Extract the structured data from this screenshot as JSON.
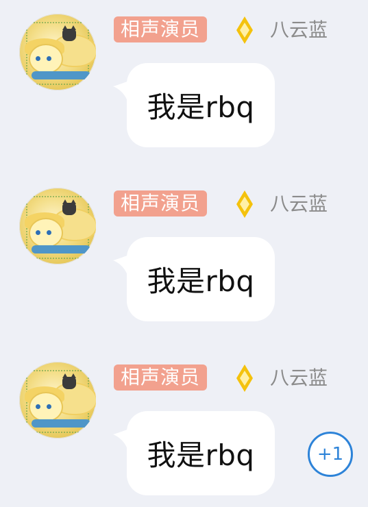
{
  "messages": [
    {
      "badge": "相声演员",
      "username": "八云蓝",
      "text": "我是rbq"
    },
    {
      "badge": "相声演员",
      "username": "八云蓝",
      "text": "我是rbq"
    },
    {
      "badge": "相声演员",
      "username": "八云蓝",
      "text": "我是rbq"
    }
  ],
  "reaction": {
    "label": "+1"
  },
  "colors": {
    "background": "#eef0f6",
    "badge_bg": "#f2a18e",
    "diamond": "#f4c20d",
    "username": "#8b8b8b",
    "bubble": "#ffffff",
    "reaction": "#2d83d8"
  },
  "icons": {
    "rank": "yellow-diamond-icon",
    "avatar": "anime-fox-avatar"
  }
}
